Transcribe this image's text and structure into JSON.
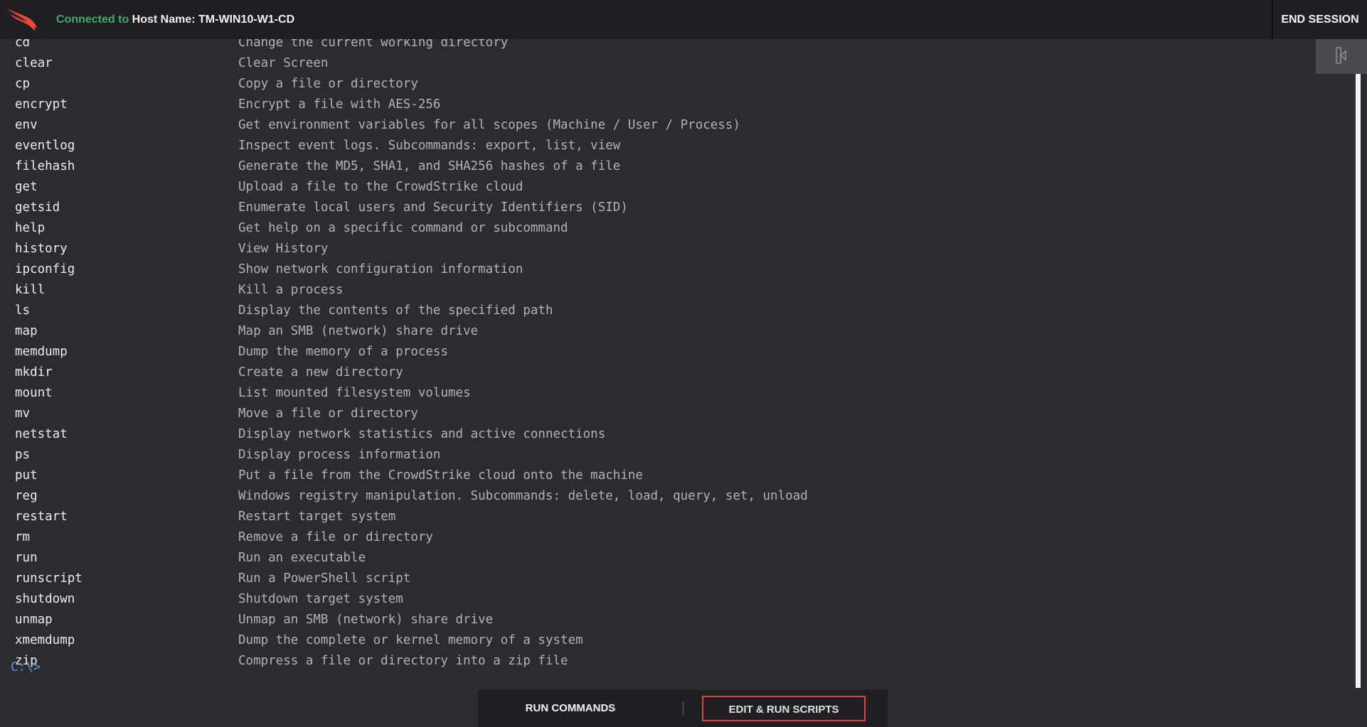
{
  "header": {
    "connected_label": "Connected to",
    "host_label": "Host Name: TM-WIN10-W1-CD",
    "end_session": "END SESSION",
    "accent_green": "#3fae6a",
    "logo_color": "#e8453c"
  },
  "terminal": {
    "commands": [
      {
        "cmd": "cd",
        "desc": "Change the current working directory"
      },
      {
        "cmd": "clear",
        "desc": "Clear Screen"
      },
      {
        "cmd": "cp",
        "desc": "Copy a file or directory"
      },
      {
        "cmd": "encrypt",
        "desc": "Encrypt a file with AES-256"
      },
      {
        "cmd": "env",
        "desc": "Get environment variables for all scopes (Machine / User / Process)"
      },
      {
        "cmd": "eventlog",
        "desc": "Inspect event logs. Subcommands: export, list, view"
      },
      {
        "cmd": "filehash",
        "desc": "Generate the MD5, SHA1, and SHA256 hashes of a file"
      },
      {
        "cmd": "get",
        "desc": "Upload a file to the CrowdStrike cloud"
      },
      {
        "cmd": "getsid",
        "desc": "Enumerate local users and Security Identifiers (SID)"
      },
      {
        "cmd": "help",
        "desc": "Get help on a specific command or subcommand"
      },
      {
        "cmd": "history",
        "desc": "View History"
      },
      {
        "cmd": "ipconfig",
        "desc": "Show network configuration information"
      },
      {
        "cmd": "kill",
        "desc": "Kill a process"
      },
      {
        "cmd": "ls",
        "desc": "Display the contents of the specified path"
      },
      {
        "cmd": "map",
        "desc": "Map an SMB (network) share drive"
      },
      {
        "cmd": "memdump",
        "desc": "Dump the memory of a process"
      },
      {
        "cmd": "mkdir",
        "desc": "Create a new directory"
      },
      {
        "cmd": "mount",
        "desc": "List mounted filesystem volumes"
      },
      {
        "cmd": "mv",
        "desc": "Move a file or directory"
      },
      {
        "cmd": "netstat",
        "desc": "Display network statistics and active connections"
      },
      {
        "cmd": "ps",
        "desc": "Display process information"
      },
      {
        "cmd": "put",
        "desc": "Put a file from the CrowdStrike cloud onto the machine"
      },
      {
        "cmd": "reg",
        "desc": "Windows registry manipulation. Subcommands: delete, load, query, set, unload"
      },
      {
        "cmd": "restart",
        "desc": "Restart target system"
      },
      {
        "cmd": "rm",
        "desc": "Remove a file or directory"
      },
      {
        "cmd": "run",
        "desc": "Run an executable"
      },
      {
        "cmd": "runscript",
        "desc": "Run a PowerShell script"
      },
      {
        "cmd": "shutdown",
        "desc": "Shutdown target system"
      },
      {
        "cmd": "unmap",
        "desc": "Unmap an SMB (network) share drive"
      },
      {
        "cmd": "xmemdump",
        "desc": "Dump the complete or kernel memory of a system"
      },
      {
        "cmd": "zip",
        "desc": "Compress a file or directory into a zip file"
      }
    ],
    "prompt": "C:\\>"
  },
  "bottom_tabs": {
    "run_commands": "RUN COMMANDS",
    "edit_run_scripts": "EDIT & RUN SCRIPTS",
    "highlight_color": "#e8403e"
  },
  "side_panel": {
    "icon": "panel-toggle-icon"
  }
}
